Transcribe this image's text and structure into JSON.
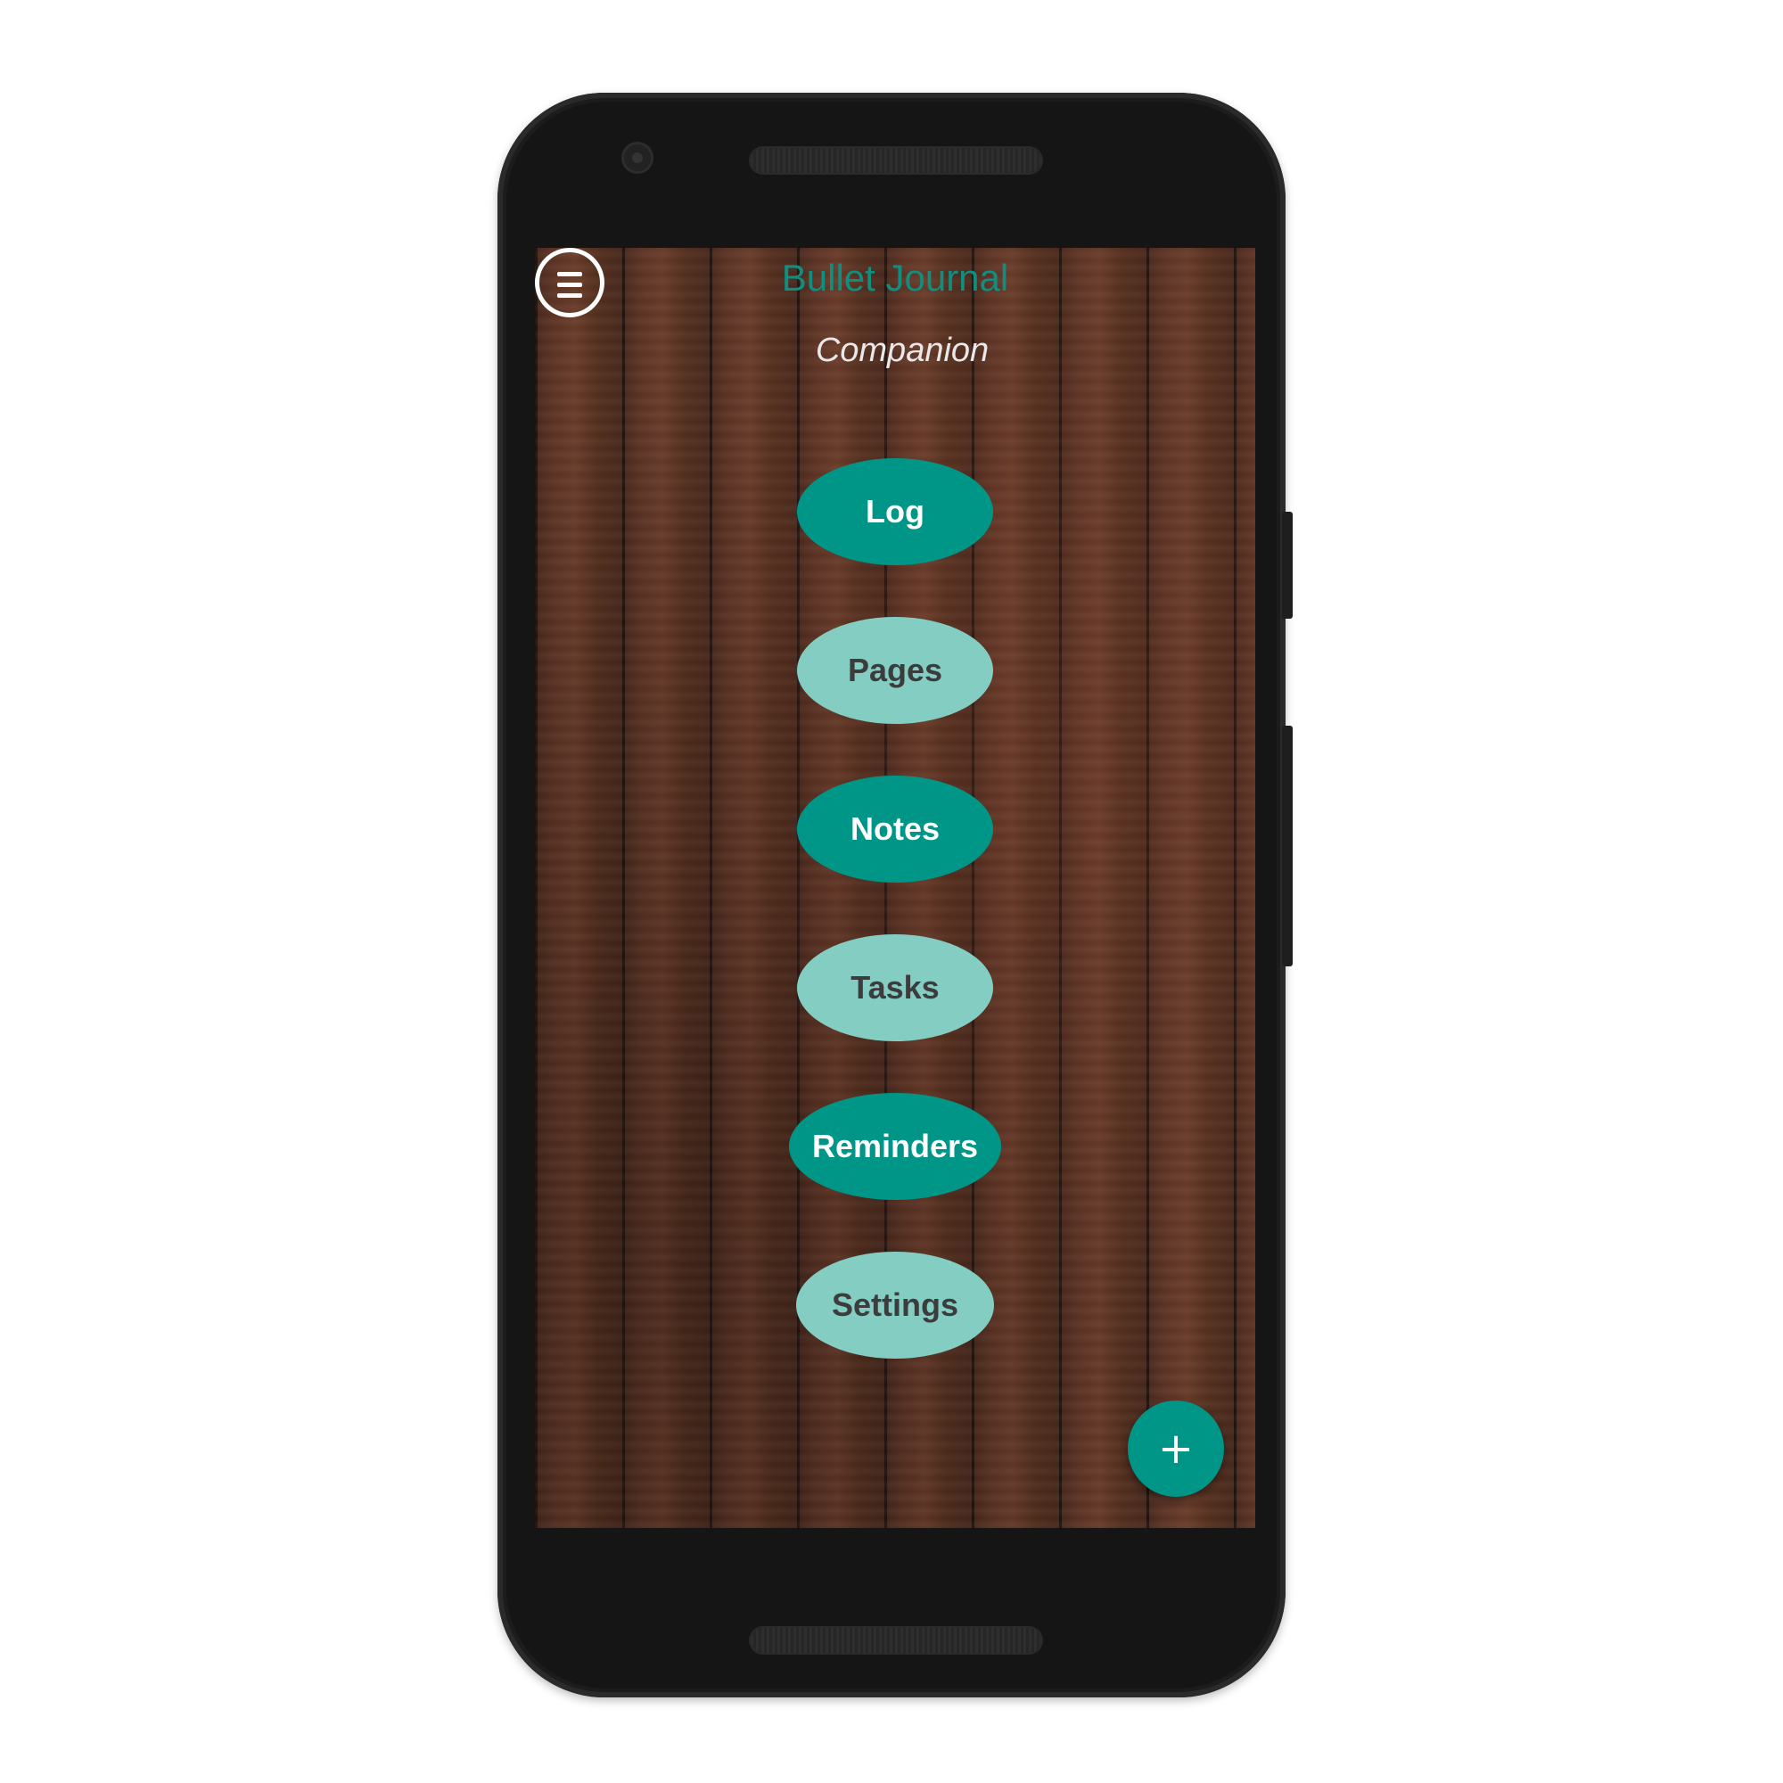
{
  "app": {
    "title": "Bullet Journal",
    "subtitle": "Companion"
  },
  "menu": {
    "icon": "menu-icon"
  },
  "nav_buttons": [
    {
      "label": "Log",
      "style": "dark"
    },
    {
      "label": "Pages",
      "style": "light"
    },
    {
      "label": "Notes",
      "style": "dark"
    },
    {
      "label": "Tasks",
      "style": "light"
    },
    {
      "label": "Reminders",
      "style": "dark"
    },
    {
      "label": "Settings",
      "style": "light"
    }
  ],
  "fab": {
    "label": "+",
    "icon": "plus-icon"
  },
  "colors": {
    "accent": "#009687",
    "accent_light": "#84cdc2",
    "title": "#0f8f80",
    "subtitle": "#e8e8e8",
    "background": "#5a3224"
  }
}
